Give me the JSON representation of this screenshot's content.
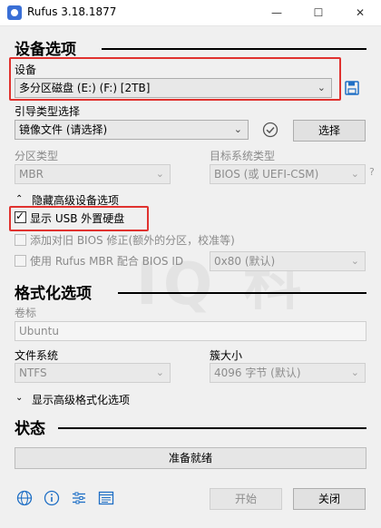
{
  "window": {
    "title": "Rufus 3.18.1877",
    "minimize": "—",
    "maximize": "☐",
    "close": "✕"
  },
  "drive_section": {
    "title": "设备选项",
    "device_label": "设备",
    "device_value": "多分区磁盘 (E:) (F:) [2TB]",
    "boot_label": "引导类型选择",
    "boot_value": "镜像文件 (请选择)",
    "select_button": "选择",
    "partition_label": "分区类型",
    "partition_value": "MBR",
    "target_label": "目标系统类型",
    "target_value": "BIOS (或 UEFI-CSM)",
    "help_mark": "?",
    "advanced_toggle": "隐藏高级设备选项",
    "show_usb": "显示 USB 外置硬盘",
    "bios_fix": "添加对旧 BIOS 修正(额外的分区，校准等)",
    "rufus_mbr": "使用 Rufus MBR 配合 BIOS ID",
    "bios_id_value": "0x80 (默认)"
  },
  "format_section": {
    "title": "格式化选项",
    "volume_label": "卷标",
    "volume_value": "Ubuntu",
    "fs_label": "文件系统",
    "fs_value": "NTFS",
    "cluster_label": "簇大小",
    "cluster_value": "4096 字节 (默认)",
    "advanced_toggle": "显示高级格式化选项"
  },
  "status_section": {
    "title": "状态",
    "status_text": "准备就绪"
  },
  "bottom": {
    "start_button": "开始",
    "close_button": "关闭"
  },
  "colors": {
    "highlight": "#e0322f",
    "accent_blue": "#1f6fc5"
  }
}
